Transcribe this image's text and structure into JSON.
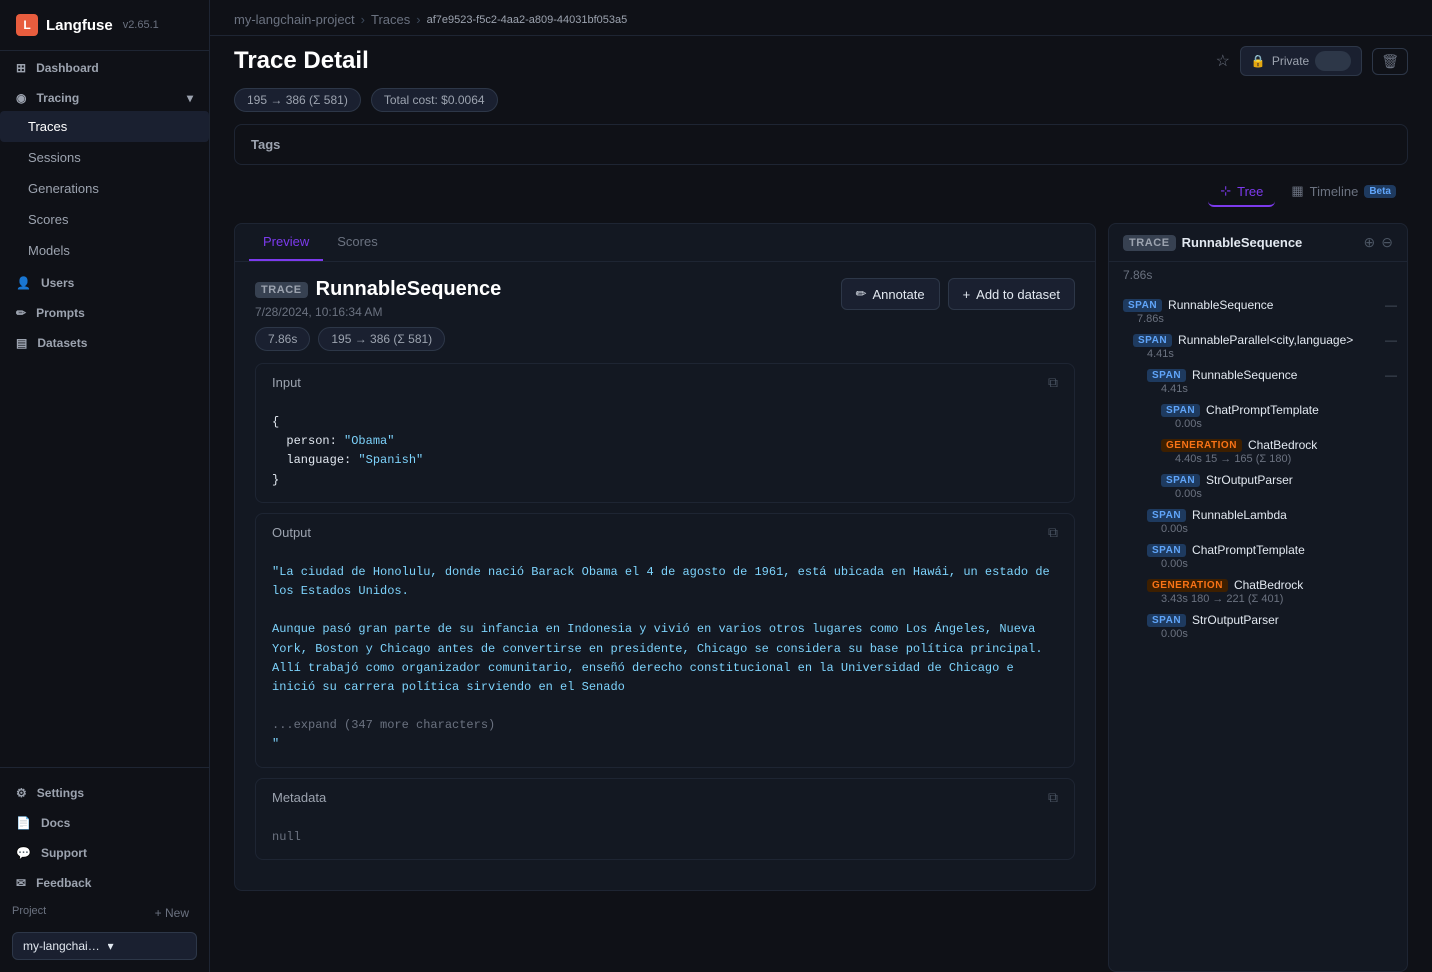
{
  "app": {
    "name": "Langfuse",
    "version": "v2.65.1"
  },
  "sidebar": {
    "items": [
      {
        "id": "dashboard",
        "label": "Dashboard",
        "icon": "⊞"
      },
      {
        "id": "tracing",
        "label": "Tracing",
        "icon": "◎",
        "expanded": true
      },
      {
        "id": "traces",
        "label": "Traces",
        "indent": true
      },
      {
        "id": "sessions",
        "label": "Sessions",
        "indent": true
      },
      {
        "id": "generations",
        "label": "Generations",
        "indent": true
      },
      {
        "id": "scores",
        "label": "Scores",
        "indent": true
      },
      {
        "id": "models",
        "label": "Models",
        "indent": true
      },
      {
        "id": "users",
        "label": "Users",
        "icon": "👤"
      },
      {
        "id": "prompts",
        "label": "Prompts",
        "icon": "✏️"
      },
      {
        "id": "datasets",
        "label": "Datasets",
        "icon": "📊"
      }
    ],
    "bottom": [
      {
        "id": "settings",
        "label": "Settings",
        "icon": "⚙"
      },
      {
        "id": "docs",
        "label": "Docs",
        "icon": "📄"
      },
      {
        "id": "support",
        "label": "Support",
        "icon": "💬"
      },
      {
        "id": "feedback",
        "label": "Feedback",
        "icon": "✉"
      }
    ],
    "project_label": "Project",
    "new_project_label": "+ New",
    "project_name": "my-langchain-pro..."
  },
  "breadcrumb": {
    "project": "my-langchain-project",
    "traces": "Traces",
    "trace_id": "af7e9523-f5c2-4aa2-a809-44031bf053a5"
  },
  "page": {
    "title": "Trace Detail",
    "private_label": "Private",
    "delete_icon": "🗑"
  },
  "stats": {
    "tokens": "195 → 386 (Σ 581)",
    "total_cost": "Total cost: $0.0064"
  },
  "tags_label": "Tags",
  "view_tabs": [
    {
      "id": "tree",
      "label": "Tree",
      "active": true
    },
    {
      "id": "timeline",
      "label": "Timeline",
      "active": false,
      "badge": "Beta"
    }
  ],
  "detail_tabs": [
    {
      "id": "preview",
      "label": "Preview",
      "active": true
    },
    {
      "id": "scores",
      "label": "Scores",
      "active": false
    }
  ],
  "trace": {
    "badge": "TRACE",
    "name": "RunnableSequence",
    "timestamp": "7/28/2024, 10:16:34 AM",
    "duration": "7.86s",
    "tokens": "195 → 386 (Σ 581)",
    "annotate_label": "Annotate",
    "add_dataset_label": "Add to dataset",
    "input_label": "Input",
    "input_content": "{\n  person: \"Obama\"\n  language: \"Spanish\"\n}",
    "output_label": "Output",
    "output_content": "\"La ciudad de Honolulu, donde nació Barack Obama el 4 de agosto de 1961, está ubicada en Hawái, un estado de los Estados Unidos.\n\nAunque pasó gran parte de su infancia en Indonesia y vivió en varios otros lugares como Los Ángeles, Nueva York, Boston y Chicago antes de convertirse en presidente, Chicago se considera su base política principal. Allí trabajó como organizador comunitario, enseñó derecho constitucional en la Universidad de Chicago e inició su carrera política sirviendo en el Senado",
    "output_expand": "...expand (347 more characters)",
    "metadata_label": "Metadata",
    "metadata_content": "null"
  },
  "tree": {
    "header_badge": "TRACE",
    "header_name": "RunnableSequence",
    "header_time": "7.86s",
    "items": [
      {
        "id": "t1",
        "indent": 0,
        "badge": "SPAN",
        "badge_type": "span",
        "name": "RunnableSequence",
        "time": "7.86s",
        "dash": "—"
      },
      {
        "id": "t2",
        "indent": 1,
        "badge": "SPAN",
        "badge_type": "span",
        "name": "RunnableParallel<city,language>",
        "time": "4.41s",
        "dash": "—"
      },
      {
        "id": "t3",
        "indent": 2,
        "badge": "SPAN",
        "badge_type": "span",
        "name": "RunnableSequence",
        "time": "4.41s",
        "dash": "—"
      },
      {
        "id": "t4",
        "indent": 3,
        "badge": "SPAN",
        "badge_type": "span",
        "name": "ChatPromptTemplate",
        "time": "0.00s",
        "dash": ""
      },
      {
        "id": "t5",
        "indent": 3,
        "badge": "GENERATION",
        "badge_type": "generation",
        "name": "ChatBedrock",
        "time": "4.40s",
        "extra": "15 → 165 (Σ 180)",
        "dash": ""
      },
      {
        "id": "t6",
        "indent": 3,
        "badge": "SPAN",
        "badge_type": "span",
        "name": "StrOutputParser",
        "time": "0.00s",
        "dash": ""
      },
      {
        "id": "t7",
        "indent": 2,
        "badge": "SPAN",
        "badge_type": "span",
        "name": "RunnableLambda",
        "time": "0.00s",
        "dash": ""
      },
      {
        "id": "t8",
        "indent": 2,
        "badge": "SPAN",
        "badge_type": "span",
        "name": "ChatPromptTemplate",
        "time": "0.00s",
        "dash": ""
      },
      {
        "id": "t9",
        "indent": 2,
        "badge": "GENERATION",
        "badge_type": "generation",
        "name": "ChatBedrock",
        "time": "3.43s",
        "extra": "180 → 221 (Σ 401)",
        "dash": ""
      },
      {
        "id": "t10",
        "indent": 2,
        "badge": "SPAN",
        "badge_type": "span",
        "name": "StrOutputParser",
        "time": "0.00s",
        "dash": ""
      }
    ]
  }
}
